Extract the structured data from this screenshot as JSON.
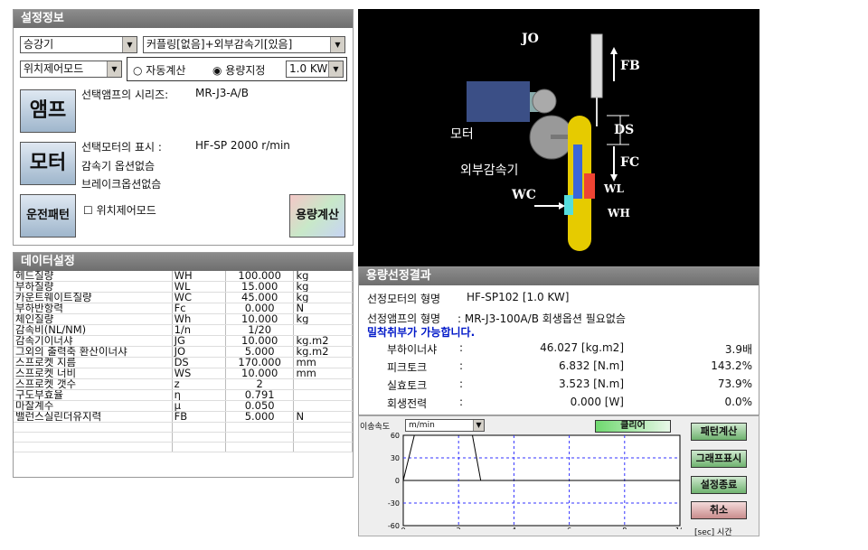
{
  "settings": {
    "title": "설정정보",
    "elevator": "승강기",
    "coupling": "커플링[없음]+외부감속기[있음]",
    "mode": "위치제어모드",
    "radio_auto": "자동계산",
    "radio_capacity": "용량지정",
    "capacity": "1.0 KW",
    "amp_btn": "앰프",
    "amp_series_label": "선택앰프의 시리즈:",
    "amp_series_value": "MR-J3-A/B",
    "motor_btn": "모터",
    "motor_label": "선택모터의 표시  :",
    "motor_value": "HF-SP   2000 r/min",
    "gear_text": "감속기 옵션없슴",
    "brake_text": "브레이크옵션없슴",
    "run_btn": "운전패턴",
    "position_check": "위치제어모드",
    "capacity_calc_btn": "용량계산"
  },
  "diagram": {
    "jo": "JO",
    "fb": "FB",
    "motor": "모터",
    "ds": "DS",
    "fc": "FC",
    "gear": "외부감속기",
    "wc": "WC",
    "wl": "WL",
    "wh": "WH"
  },
  "data_settings": {
    "title": "데이터설정",
    "rows": [
      [
        "헤드질량",
        "WH",
        "100.000",
        "kg"
      ],
      [
        "부하질량",
        "WL",
        "15.000",
        "kg"
      ],
      [
        "카운트웨이트질량",
        "WC",
        "45.000",
        "kg"
      ],
      [
        "부하반항력",
        "Fc",
        "0.000",
        "N"
      ],
      [
        "체인질량",
        "Wh",
        "10.000",
        "kg"
      ],
      [
        "감속비(NL/NM)",
        "1/n",
        "1/20",
        ""
      ],
      [
        "감속기이너샤",
        "JG",
        "10.000",
        "kg.m2"
      ],
      [
        "그외의 출력축 환산이너샤",
        "JO",
        "5.000",
        "kg.m2"
      ],
      [
        "스프로켓 지름",
        "DS",
        "170.000",
        "mm"
      ],
      [
        "스프로켓 너비",
        "WS",
        "10.000",
        "mm"
      ],
      [
        "스프로켓 갯수",
        "z",
        "2",
        ""
      ],
      [
        "구도부효율",
        "η",
        "0.791",
        ""
      ],
      [
        "마찰계수",
        "μ",
        "0.050",
        ""
      ],
      [
        "밸런스실린더유지력",
        "FB",
        "5.000",
        "N"
      ],
      [
        "",
        "",
        "",
        ""
      ],
      [
        "",
        "",
        "",
        ""
      ],
      [
        "",
        "",
        "",
        ""
      ]
    ]
  },
  "result": {
    "title": "용량선정결과",
    "motor_label": "선정모터의 형명",
    "motor_value": "HF-SP102 [1.0 KW]",
    "amp_label": "선정앰프의 형명",
    "amp_value": ": MR-J3-100A/B 회생옵션 필요없슴",
    "notice": "밀착취부가 가능합니다.",
    "rows": [
      [
        "부하이너샤",
        ":",
        "46.027 [kg.m2]",
        "3.9배"
      ],
      [
        "피크토크",
        ":",
        "6.832 [N.m]",
        "143.2%"
      ],
      [
        "실효토크",
        ":",
        "3.523 [N.m]",
        "73.9%"
      ],
      [
        "회생전력",
        ":",
        "0.000 [W]",
        "0.0%"
      ]
    ]
  },
  "chart_controls": {
    "speed_label": "이송속도",
    "unit": "m/min",
    "clear_btn": "클리어",
    "pattern_btn": "패턴계산",
    "graph_btn": "그래프표시",
    "end_btn": "설정종료",
    "cancel_btn": "취소",
    "xunit": "[sec] 시간"
  },
  "chart_data": {
    "type": "line",
    "ylim": [
      -60,
      60
    ],
    "xlim": [
      0,
      10
    ],
    "yticks": [
      60,
      30,
      0,
      -30,
      -60
    ],
    "xticks": [
      0,
      2,
      4,
      6,
      8,
      10
    ],
    "series": [
      {
        "values": [
          [
            0,
            0
          ],
          [
            0.4,
            60
          ],
          [
            2.0,
            60
          ],
          [
            2.5,
            60
          ],
          [
            2.8,
            0
          ],
          [
            10,
            0
          ]
        ]
      }
    ]
  }
}
